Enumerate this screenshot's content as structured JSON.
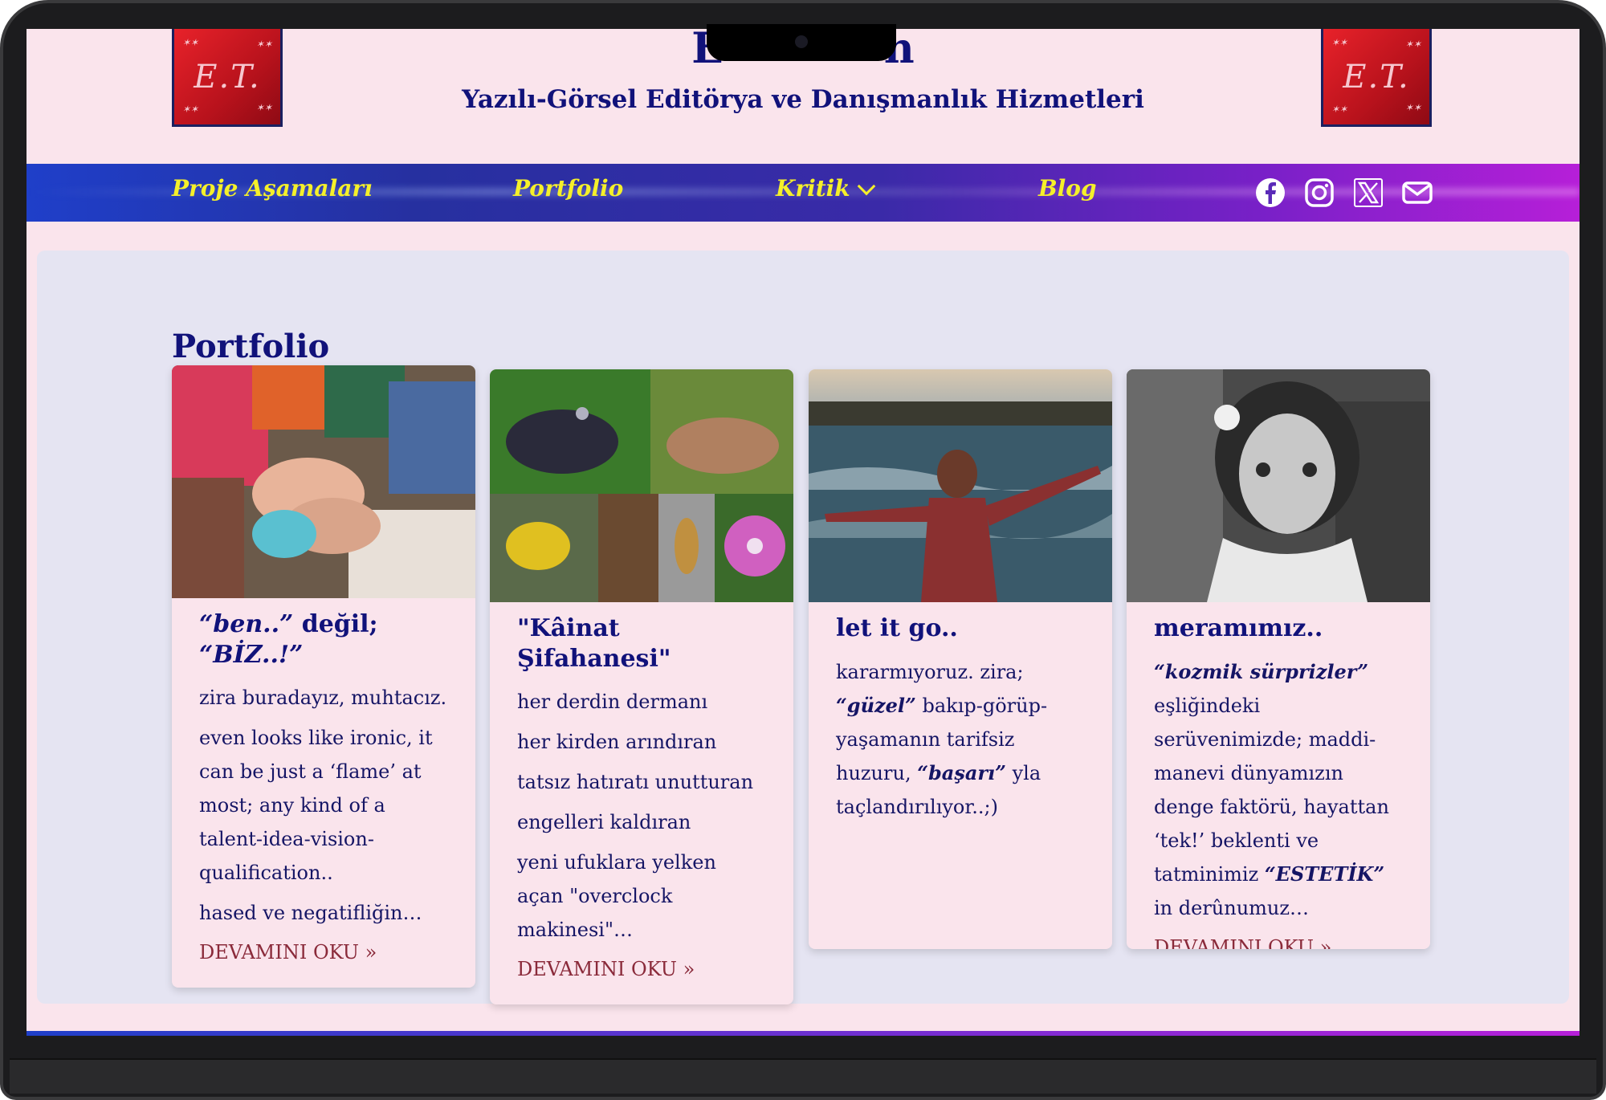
{
  "site": {
    "title_partial_left": "E",
    "title_partial_right": "n",
    "tagline": "Yazılı-Görsel Editörya ve Danışmanlık Hizmetleri",
    "logo_text": "E.T."
  },
  "nav": {
    "items": [
      {
        "label": "Proje Aşamaları"
      },
      {
        "label": "Portfolio"
      },
      {
        "label": "Kritik"
      },
      {
        "label": "Blog"
      }
    ],
    "social": [
      "facebook-icon",
      "instagram-icon",
      "x-icon",
      "mail-icon"
    ],
    "accent": "#f5f02a"
  },
  "portfolio": {
    "title": "Portfolio",
    "cards": [
      {
        "title_parts": [
          "“ben..”",
          " değil; ",
          "“BİZ..!”"
        ],
        "paragraphs": [
          "zira buradayız, muhtacız.",
          "even looks like ironic, it can be just a ‘flame’ at most; any kind of a talent-idea-vision-qualification..",
          "hased ve negatifliğin…"
        ],
        "more": "DEVAMINI OKU »"
      },
      {
        "title": "\"Kâinat Şifahanesi\"",
        "paragraphs": [
          "her derdin dermanı",
          "her kirden arındıran",
          "tatsız hatıratı unutturan",
          "engelleri kaldıran",
          "yeni ufuklara yelken açan \"overclock makinesi\"…"
        ],
        "more": "DEVAMINI OKU »"
      },
      {
        "title": "let it go..",
        "text_parts": [
          "kararmıyoruz. zira; ",
          "“güzel”",
          " bakıp-görüp-yaşamanın tarifsiz huzuru, ",
          "“başarı”",
          " yla taçlandırılıyor..;)"
        ]
      },
      {
        "title": "meramımız..",
        "text_parts": [
          "“kozmik sürprizler”",
          " eşliğindeki serüvenimizde; maddi-manevi dünyamızın denge faktörü, hayattan ‘tek!’ beklenti ve tatminimiz ",
          "“ESTETİK”",
          " in derûnumuz…"
        ],
        "more": "DEVAMINI OKU »"
      }
    ]
  }
}
